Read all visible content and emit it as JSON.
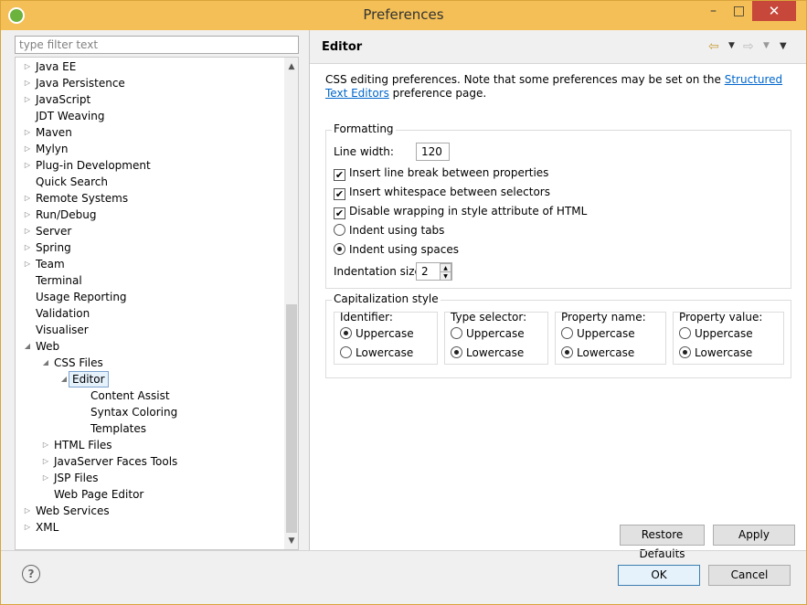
{
  "window": {
    "title": "Preferences",
    "minimize": "–",
    "maximize": "□",
    "close": "✕"
  },
  "filter": {
    "placeholder": "type filter text"
  },
  "tree": [
    {
      "label": "Java EE",
      "depth": 0,
      "expander": "collapsed"
    },
    {
      "label": "Java Persistence",
      "depth": 0,
      "expander": "collapsed"
    },
    {
      "label": "JavaScript",
      "depth": 0,
      "expander": "collapsed"
    },
    {
      "label": "JDT Weaving",
      "depth": 0,
      "expander": "none"
    },
    {
      "label": "Maven",
      "depth": 0,
      "expander": "collapsed"
    },
    {
      "label": "Mylyn",
      "depth": 0,
      "expander": "collapsed"
    },
    {
      "label": "Plug-in Development",
      "depth": 0,
      "expander": "collapsed"
    },
    {
      "label": "Quick Search",
      "depth": 0,
      "expander": "none"
    },
    {
      "label": "Remote Systems",
      "depth": 0,
      "expander": "collapsed"
    },
    {
      "label": "Run/Debug",
      "depth": 0,
      "expander": "collapsed"
    },
    {
      "label": "Server",
      "depth": 0,
      "expander": "collapsed"
    },
    {
      "label": "Spring",
      "depth": 0,
      "expander": "collapsed"
    },
    {
      "label": "Team",
      "depth": 0,
      "expander": "collapsed"
    },
    {
      "label": "Terminal",
      "depth": 0,
      "expander": "none"
    },
    {
      "label": "Usage Reporting",
      "depth": 0,
      "expander": "none"
    },
    {
      "label": "Validation",
      "depth": 0,
      "expander": "none"
    },
    {
      "label": "Visualiser",
      "depth": 0,
      "expander": "none"
    },
    {
      "label": "Web",
      "depth": 0,
      "expander": "expanded"
    },
    {
      "label": "CSS Files",
      "depth": 1,
      "expander": "expanded"
    },
    {
      "label": "Editor",
      "depth": 2,
      "expander": "expanded",
      "selected": true
    },
    {
      "label": "Content Assist",
      "depth": 3,
      "expander": "none"
    },
    {
      "label": "Syntax Coloring",
      "depth": 3,
      "expander": "none"
    },
    {
      "label": "Templates",
      "depth": 3,
      "expander": "none"
    },
    {
      "label": "HTML Files",
      "depth": 1,
      "expander": "collapsed"
    },
    {
      "label": "JavaServer Faces Tools",
      "depth": 1,
      "expander": "collapsed"
    },
    {
      "label": "JSP Files",
      "depth": 1,
      "expander": "collapsed"
    },
    {
      "label": "Web Page Editor",
      "depth": 1,
      "expander": "none"
    },
    {
      "label": "Web Services",
      "depth": 0,
      "expander": "collapsed"
    },
    {
      "label": "XML",
      "depth": 0,
      "expander": "collapsed"
    }
  ],
  "page": {
    "title": "Editor",
    "description_prefix": "CSS editing preferences.  Note that some preferences may be set on the ",
    "description_link": "Structured Text Editors",
    "description_suffix": " preference page."
  },
  "formatting": {
    "title": "Formatting",
    "line_width_label": "Line width:",
    "line_width_value": "120",
    "checks": [
      {
        "label": "Insert line break between properties",
        "checked": true
      },
      {
        "label": "Insert whitespace between selectors",
        "checked": true
      },
      {
        "label": "Disable wrapping in style attribute of HTML",
        "checked": true
      }
    ],
    "radios": [
      {
        "label": "Indent using tabs",
        "selected": false
      },
      {
        "label": "Indent using spaces",
        "selected": true
      }
    ],
    "indent_size_label": "Indentation size:",
    "indent_size_value": "2"
  },
  "capitalization": {
    "title": "Capitalization style",
    "groups": [
      {
        "title": "Identifier:",
        "upper": "Uppercase",
        "lower": "Lowercase",
        "selected": "upper"
      },
      {
        "title": "Type selector:",
        "upper": "Uppercase",
        "lower": "Lowercase",
        "selected": "lower"
      },
      {
        "title": "Property name:",
        "upper": "Uppercase",
        "lower": "Lowercase",
        "selected": "lower"
      },
      {
        "title": "Property value:",
        "upper": "Uppercase",
        "lower": "Lowercase",
        "selected": "lower"
      }
    ]
  },
  "buttons": {
    "restore": "Restore Defaults",
    "apply": "Apply",
    "ok": "OK",
    "cancel": "Cancel",
    "help": "?"
  },
  "icons": {
    "app": "spring-leaf-icon",
    "back": "arrow-left-icon",
    "forward": "arrow-right-icon",
    "menu": "view-menu-icon"
  }
}
